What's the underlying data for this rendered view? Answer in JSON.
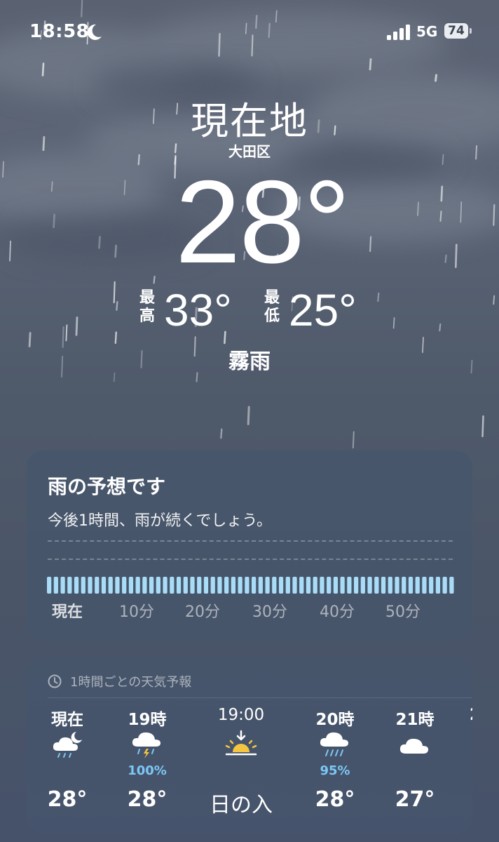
{
  "status_bar": {
    "time": "18:58",
    "network": "5G",
    "battery": "74"
  },
  "hero": {
    "location": "現在地",
    "district": "大田区",
    "temperature": "28°",
    "high_label": "最高",
    "high": "33°",
    "low_label": "最低",
    "low": "25°",
    "condition": "霧雨"
  },
  "rain_card": {
    "title": "雨の予想です",
    "subtitle": "今後1時間、雨が続くでしょう。",
    "axis_labels": [
      "現在",
      "10分",
      "20分",
      "30分",
      "40分",
      "50分"
    ]
  },
  "hourly_card": {
    "header": "1時間ごとの天気予報",
    "hours": [
      {
        "label": "現在",
        "icon": "cloud-moon-rain-icon",
        "precip": "",
        "temp": "28°"
      },
      {
        "label": "19時",
        "icon": "cloud-bolt-rain-icon",
        "precip": "100%",
        "temp": "28°"
      },
      {
        "label": "19:00",
        "icon": "sunset-icon",
        "precip": "",
        "temp": "日の入"
      },
      {
        "label": "20時",
        "icon": "cloud-rain-icon",
        "precip": "95%",
        "temp": "28°"
      },
      {
        "label": "21時",
        "icon": "cloud-icon",
        "precip": "",
        "temp": "27°"
      }
    ],
    "next_partial": "2"
  },
  "colors": {
    "accent_precip": "#7cc7f4",
    "rain_bar": "#a9dcf7"
  }
}
